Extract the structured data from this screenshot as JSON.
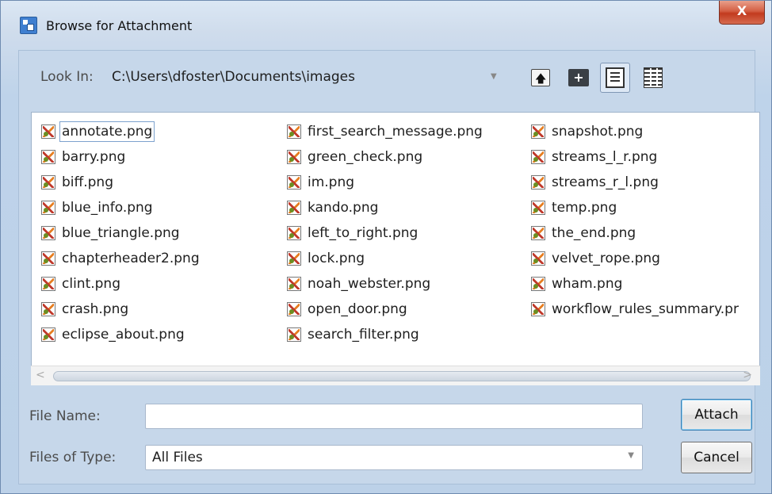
{
  "window": {
    "title": "Browse for Attachment",
    "close_glyph": "X"
  },
  "lookin": {
    "label": "Look In:",
    "path": "C:\\Users\\dfoster\\Documents\\images",
    "dropdown_glyph": "▼"
  },
  "toolbar": {
    "icons": [
      "folder-up-icon",
      "new-folder-icon",
      "list-view-icon",
      "details-view-icon"
    ],
    "new_folder_glyph": "+"
  },
  "files": {
    "columns": [
      [
        "annotate.png",
        "barry.png",
        "biff.png",
        "blue_info.png",
        "blue_triangle.png",
        "chapterheader2.png",
        "clint.png",
        "crash.png",
        "eclipse_about.png"
      ],
      [
        "first_search_message.png",
        "green_check.png",
        "im.png",
        "kando.png",
        "left_to_right.png",
        "lock.png",
        "noah_webster.png",
        "open_door.png",
        "search_filter.png"
      ],
      [
        "snapshot.png",
        "streams_l_r.png",
        "streams_r_l.png",
        "temp.png",
        "the_end.png",
        "velvet_rope.png",
        "wham.png",
        "workflow_rules_summary.pr"
      ]
    ],
    "selected": "annotate.png"
  },
  "scroll": {
    "left_glyph": "<",
    "right_glyph": ">"
  },
  "form": {
    "file_name_label": "File Name:",
    "file_name_value": "",
    "files_of_type_label": "Files of Type:",
    "files_of_type_value": "All Files",
    "combo_glyph": "▼"
  },
  "buttons": {
    "attach": "Attach",
    "cancel": "Cancel"
  },
  "colors": {
    "close_button": "#c23a1e",
    "dialog_background": "#c6d7ea",
    "default_button_border": "#3c7fb1"
  }
}
